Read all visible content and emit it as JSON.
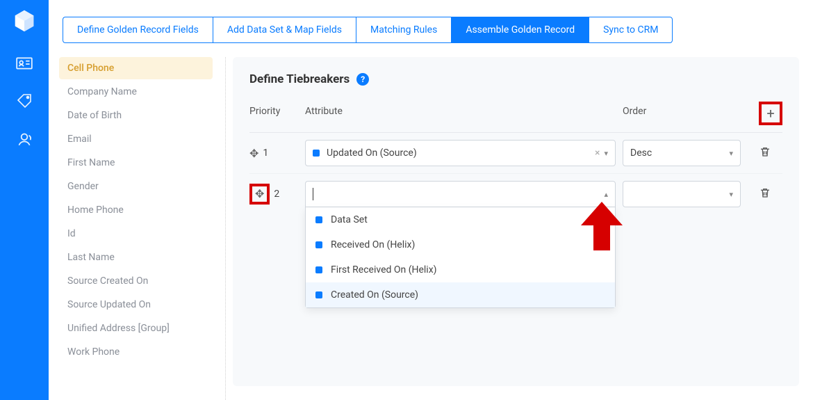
{
  "tabs": [
    {
      "label": "Define Golden Record Fields",
      "active": false
    },
    {
      "label": "Add Data Set & Map Fields",
      "active": false
    },
    {
      "label": "Matching Rules",
      "active": false
    },
    {
      "label": "Assemble Golden Record",
      "active": true
    },
    {
      "label": "Sync to CRM",
      "active": false
    }
  ],
  "fields": [
    {
      "label": "Cell Phone",
      "selected": true
    },
    {
      "label": "Company Name",
      "selected": false
    },
    {
      "label": "Date of Birth",
      "selected": false
    },
    {
      "label": "Email",
      "selected": false
    },
    {
      "label": "First Name",
      "selected": false
    },
    {
      "label": "Gender",
      "selected": false
    },
    {
      "label": "Home Phone",
      "selected": false
    },
    {
      "label": "Id",
      "selected": false
    },
    {
      "label": "Last Name",
      "selected": false
    },
    {
      "label": "Source Created On",
      "selected": false
    },
    {
      "label": "Source Updated On",
      "selected": false
    },
    {
      "label": "Unified Address [Group]",
      "selected": false
    },
    {
      "label": "Work Phone",
      "selected": false
    }
  ],
  "panel": {
    "title": "Define Tiebreakers",
    "columns": {
      "priority": "Priority",
      "attribute": "Attribute",
      "order": "Order"
    },
    "rows": [
      {
        "priority": "1",
        "attribute": "Updated On (Source)",
        "order": "Desc",
        "open": false,
        "boxed": false
      },
      {
        "priority": "2",
        "attribute": "",
        "order": "",
        "open": true,
        "boxed": true
      }
    ],
    "dropdown_options": [
      {
        "label": "Data Set",
        "hover": false
      },
      {
        "label": "Received On (Helix)",
        "hover": false
      },
      {
        "label": "First Received On (Helix)",
        "hover": false
      },
      {
        "label": "Created On (Source)",
        "hover": true
      }
    ]
  },
  "icons": {
    "help": "?",
    "plus": "+",
    "clear": "×",
    "caret_down": "▾",
    "caret_up": "▴"
  }
}
